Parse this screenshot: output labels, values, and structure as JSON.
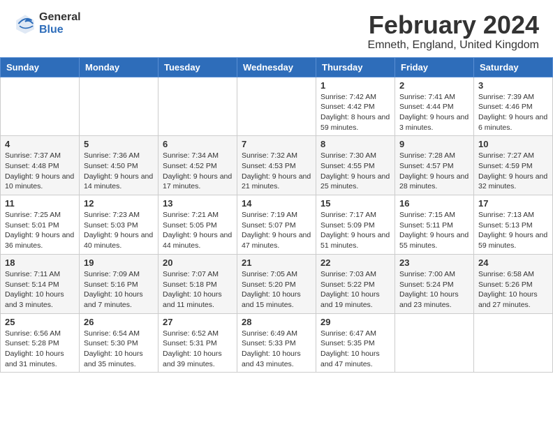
{
  "header": {
    "logo_general": "General",
    "logo_blue": "Blue",
    "title": "February 2024",
    "location": "Emneth, England, United Kingdom"
  },
  "days_of_week": [
    "Sunday",
    "Monday",
    "Tuesday",
    "Wednesday",
    "Thursday",
    "Friday",
    "Saturday"
  ],
  "weeks": [
    [
      {
        "day": "",
        "info": ""
      },
      {
        "day": "",
        "info": ""
      },
      {
        "day": "",
        "info": ""
      },
      {
        "day": "",
        "info": ""
      },
      {
        "day": "1",
        "info": "Sunrise: 7:42 AM\nSunset: 4:42 PM\nDaylight: 8 hours and 59 minutes."
      },
      {
        "day": "2",
        "info": "Sunrise: 7:41 AM\nSunset: 4:44 PM\nDaylight: 9 hours and 3 minutes."
      },
      {
        "day": "3",
        "info": "Sunrise: 7:39 AM\nSunset: 4:46 PM\nDaylight: 9 hours and 6 minutes."
      }
    ],
    [
      {
        "day": "4",
        "info": "Sunrise: 7:37 AM\nSunset: 4:48 PM\nDaylight: 9 hours and 10 minutes."
      },
      {
        "day": "5",
        "info": "Sunrise: 7:36 AM\nSunset: 4:50 PM\nDaylight: 9 hours and 14 minutes."
      },
      {
        "day": "6",
        "info": "Sunrise: 7:34 AM\nSunset: 4:52 PM\nDaylight: 9 hours and 17 minutes."
      },
      {
        "day": "7",
        "info": "Sunrise: 7:32 AM\nSunset: 4:53 PM\nDaylight: 9 hours and 21 minutes."
      },
      {
        "day": "8",
        "info": "Sunrise: 7:30 AM\nSunset: 4:55 PM\nDaylight: 9 hours and 25 minutes."
      },
      {
        "day": "9",
        "info": "Sunrise: 7:28 AM\nSunset: 4:57 PM\nDaylight: 9 hours and 28 minutes."
      },
      {
        "day": "10",
        "info": "Sunrise: 7:27 AM\nSunset: 4:59 PM\nDaylight: 9 hours and 32 minutes."
      }
    ],
    [
      {
        "day": "11",
        "info": "Sunrise: 7:25 AM\nSunset: 5:01 PM\nDaylight: 9 hours and 36 minutes."
      },
      {
        "day": "12",
        "info": "Sunrise: 7:23 AM\nSunset: 5:03 PM\nDaylight: 9 hours and 40 minutes."
      },
      {
        "day": "13",
        "info": "Sunrise: 7:21 AM\nSunset: 5:05 PM\nDaylight: 9 hours and 44 minutes."
      },
      {
        "day": "14",
        "info": "Sunrise: 7:19 AM\nSunset: 5:07 PM\nDaylight: 9 hours and 47 minutes."
      },
      {
        "day": "15",
        "info": "Sunrise: 7:17 AM\nSunset: 5:09 PM\nDaylight: 9 hours and 51 minutes."
      },
      {
        "day": "16",
        "info": "Sunrise: 7:15 AM\nSunset: 5:11 PM\nDaylight: 9 hours and 55 minutes."
      },
      {
        "day": "17",
        "info": "Sunrise: 7:13 AM\nSunset: 5:13 PM\nDaylight: 9 hours and 59 minutes."
      }
    ],
    [
      {
        "day": "18",
        "info": "Sunrise: 7:11 AM\nSunset: 5:14 PM\nDaylight: 10 hours and 3 minutes."
      },
      {
        "day": "19",
        "info": "Sunrise: 7:09 AM\nSunset: 5:16 PM\nDaylight: 10 hours and 7 minutes."
      },
      {
        "day": "20",
        "info": "Sunrise: 7:07 AM\nSunset: 5:18 PM\nDaylight: 10 hours and 11 minutes."
      },
      {
        "day": "21",
        "info": "Sunrise: 7:05 AM\nSunset: 5:20 PM\nDaylight: 10 hours and 15 minutes."
      },
      {
        "day": "22",
        "info": "Sunrise: 7:03 AM\nSunset: 5:22 PM\nDaylight: 10 hours and 19 minutes."
      },
      {
        "day": "23",
        "info": "Sunrise: 7:00 AM\nSunset: 5:24 PM\nDaylight: 10 hours and 23 minutes."
      },
      {
        "day": "24",
        "info": "Sunrise: 6:58 AM\nSunset: 5:26 PM\nDaylight: 10 hours and 27 minutes."
      }
    ],
    [
      {
        "day": "25",
        "info": "Sunrise: 6:56 AM\nSunset: 5:28 PM\nDaylight: 10 hours and 31 minutes."
      },
      {
        "day": "26",
        "info": "Sunrise: 6:54 AM\nSunset: 5:30 PM\nDaylight: 10 hours and 35 minutes."
      },
      {
        "day": "27",
        "info": "Sunrise: 6:52 AM\nSunset: 5:31 PM\nDaylight: 10 hours and 39 minutes."
      },
      {
        "day": "28",
        "info": "Sunrise: 6:49 AM\nSunset: 5:33 PM\nDaylight: 10 hours and 43 minutes."
      },
      {
        "day": "29",
        "info": "Sunrise: 6:47 AM\nSunset: 5:35 PM\nDaylight: 10 hours and 47 minutes."
      },
      {
        "day": "",
        "info": ""
      },
      {
        "day": "",
        "info": ""
      }
    ]
  ]
}
